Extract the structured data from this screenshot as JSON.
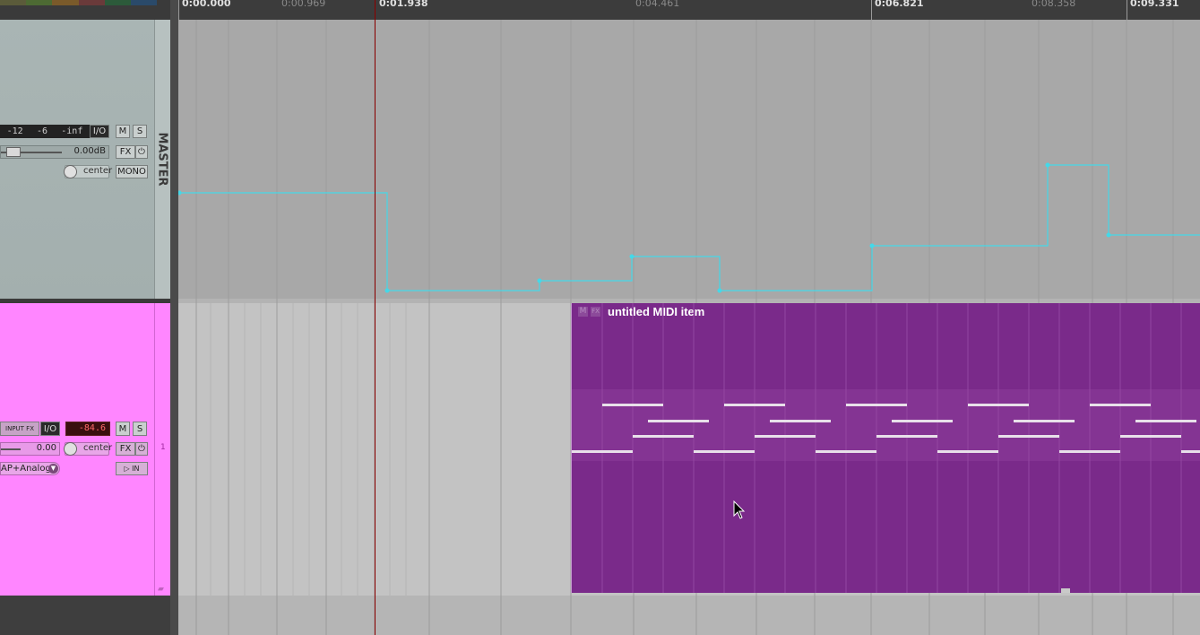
{
  "ruler": {
    "major_labels": [
      "0:00.000",
      "0:01.938",
      "0:06.821",
      "0:09.331"
    ],
    "minor_labels": [
      "0:00.969",
      "0:04.461",
      "0:08.358"
    ]
  },
  "master_track": {
    "label": "MASTER",
    "meter_scale": [
      "-12",
      "-6",
      "-inf"
    ],
    "io_label": "I/O",
    "mute_label": "M",
    "solo_label": "S",
    "volume_value": "0.00dB",
    "fx_label": "FX",
    "pan_value": "center",
    "mono_label": "MONO"
  },
  "track1": {
    "number": "1",
    "input_fx_label": "INPUT FX",
    "io_label": "I/O",
    "meter_value": "-84.6",
    "mute_label": "M",
    "solo_label": "S",
    "volume_value": "0.00",
    "pan_value": "center",
    "fx_label": "FX",
    "input_name": "AP+Analog I",
    "record_monitor_label": "IN"
  },
  "midi_item": {
    "name": "untitled MIDI item",
    "badge_m": "M",
    "badge_fx": "FX",
    "color": "#7a2a8a"
  },
  "colors": {
    "master_lane": "#a8a8a8",
    "track1_tcp": "#ff86ff",
    "automation": "#44d8e8",
    "playhead": "#8b0000"
  }
}
